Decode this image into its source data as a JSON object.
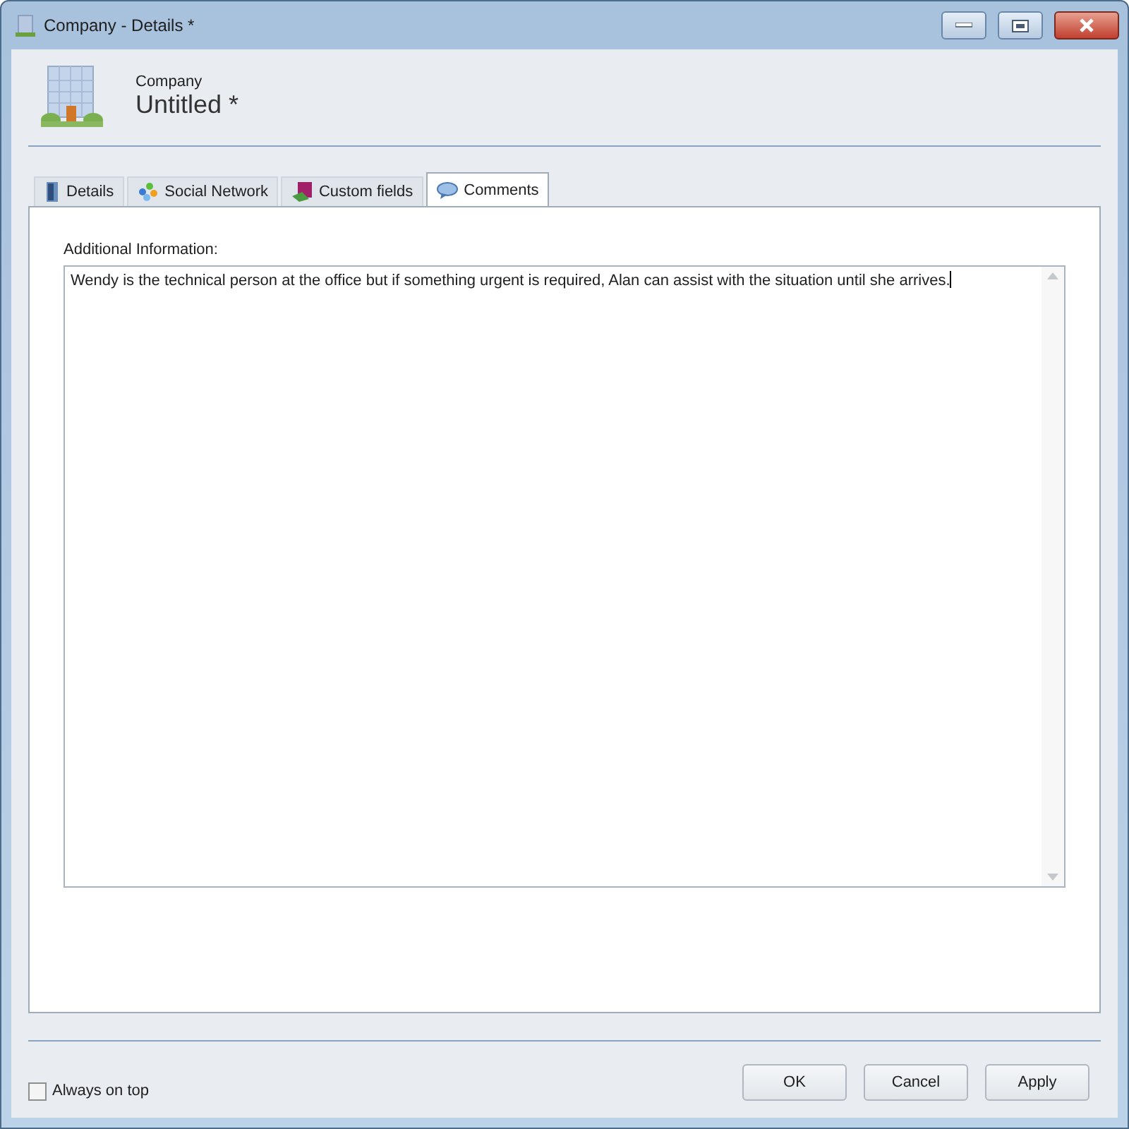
{
  "window": {
    "title": "Company - Details *"
  },
  "header": {
    "caption": "Company",
    "name": "Untitled *"
  },
  "tabs": [
    {
      "label": "Details",
      "kind": "details",
      "selected": false
    },
    {
      "label": "Social Network",
      "kind": "social",
      "selected": false
    },
    {
      "label": "Custom fields",
      "kind": "custom",
      "selected": false
    },
    {
      "label": "Comments",
      "kind": "comments",
      "selected": true
    }
  ],
  "comments": {
    "label": "Additional Information:",
    "value": "Wendy is the technical person at the office but if something urgent is required, Alan can assist with the situation until she arrives."
  },
  "always_on_top": {
    "label": "Always on top",
    "checked": false
  },
  "buttons": [
    "OK",
    "Cancel",
    "Apply"
  ]
}
